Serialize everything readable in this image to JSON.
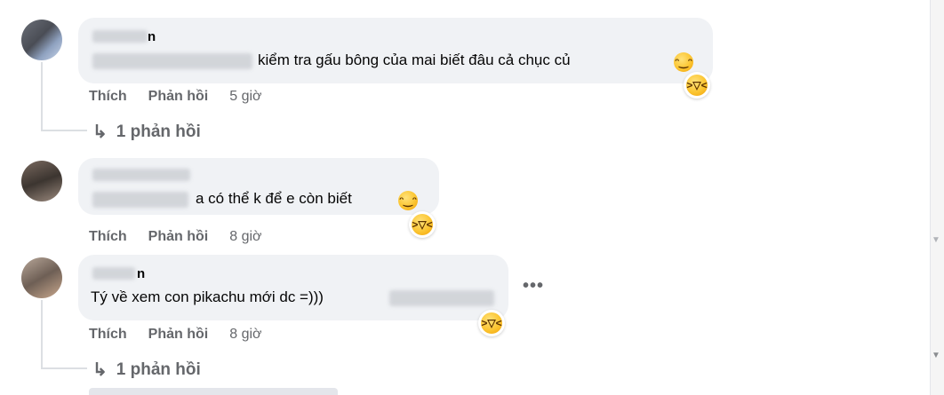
{
  "comments": [
    {
      "name_visible": "n",
      "text": "kiểm tra gấu bông của mai biết đâu cả chục củ",
      "inline_emoji": "😂",
      "reaction": "😆",
      "actions": {
        "like": "Thích",
        "reply": "Phản hồi",
        "time": "5 giờ"
      },
      "replies": "1 phản hồi"
    },
    {
      "text": "a có thể k để e còn biết",
      "inline_emoji": "🤣",
      "reaction": "😆",
      "actions": {
        "like": "Thích",
        "reply": "Phản hồi",
        "time": "8 giờ"
      }
    },
    {
      "name_visible": "n",
      "text": "Tý về xem con pikachu mới dc =)))",
      "reaction": "😆",
      "actions": {
        "like": "Thích",
        "reply": "Phản hồi",
        "time": "8 giờ"
      },
      "more": "•••",
      "replies": "1 phản hồi"
    }
  ],
  "icons": {
    "reply_arrow": "↳",
    "scroll_down": "▼"
  }
}
